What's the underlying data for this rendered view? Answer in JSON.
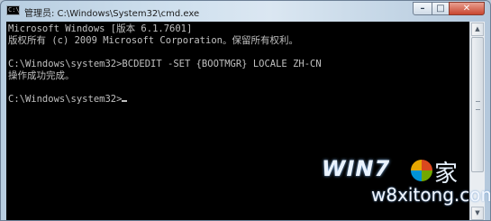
{
  "window": {
    "title": "管理员: C:\\Windows\\System32\\cmd.exe",
    "icon_label": "C:\\",
    "controls": {
      "minimize": "–",
      "maximize": "□",
      "close": "✕"
    }
  },
  "console": {
    "lines": [
      "Microsoft Windows [版本 6.1.7601]",
      "版权所有 (c) 2009 Microsoft Corporation。保留所有权利。",
      "",
      "C:\\Windows\\system32>BCDEDIT -SET {BOOTMGR} LOCALE ZH-CN",
      "操作成功完成。",
      "",
      "C:\\Windows\\system32>"
    ]
  },
  "scrollbar": {
    "up": "▲",
    "down": "▼"
  },
  "watermark": {
    "logo": "WIN7",
    "char": "家",
    "site": "w8xitong.com"
  },
  "colors": {
    "console_bg": "#000000",
    "console_text": "#c0c0c0",
    "close_button": "#c9462f"
  }
}
